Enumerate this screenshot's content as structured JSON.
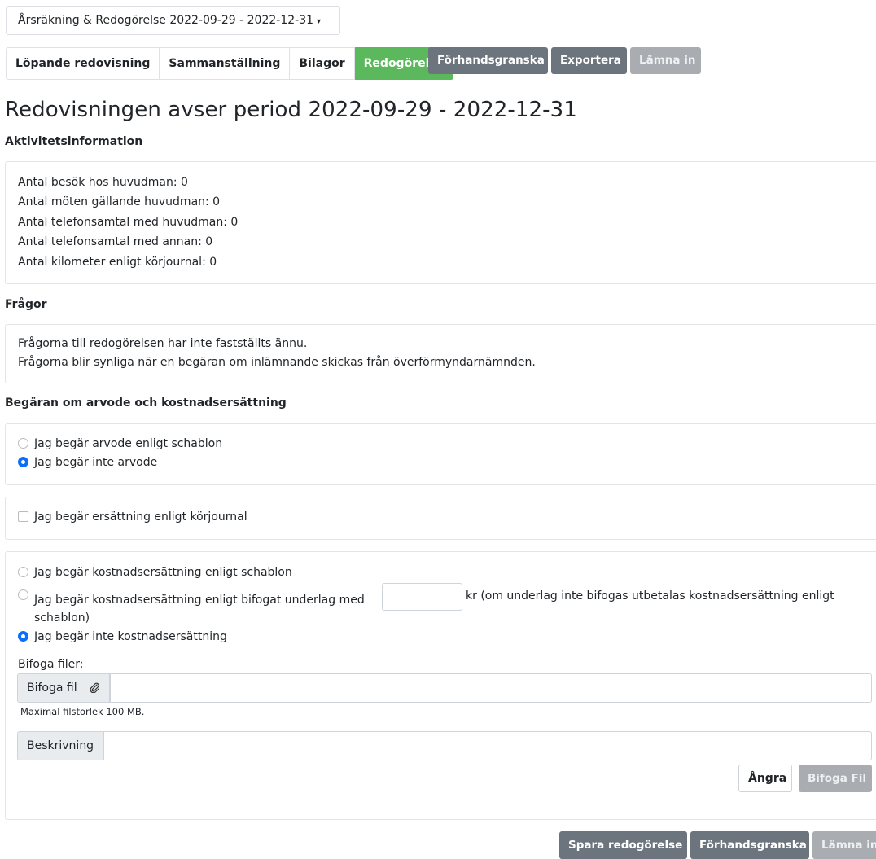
{
  "period_selector": {
    "label": "Årsräkning & Redogörelse 2022-09-29 - 2022-12-31",
    "caret": "▾"
  },
  "tabs": [
    {
      "label": "Löpande redovisning"
    },
    {
      "label": "Sammanställning"
    },
    {
      "label": "Bilagor"
    },
    {
      "label": "Redogörelse"
    }
  ],
  "top_actions": {
    "preview": "Förhandsgranska",
    "export": "Exportera",
    "submit": "Lämna in"
  },
  "title": "Redovisningen avser period 2022-09-29 - 2022-12-31",
  "activity": {
    "heading": "Aktivitetsinformation",
    "lines": [
      "Antal besök hos huvudman: 0",
      "Antal möten gällande huvudman: 0",
      "Antal telefonsamtal med huvudman: 0",
      "Antal telefonsamtal med annan: 0",
      "Antal kilometer enligt körjournal: 0"
    ]
  },
  "questions": {
    "heading": "Frågor",
    "lines": [
      "Frågorna till redogörelsen har inte fastställts ännu.",
      "Frågorna blir synliga när en begäran om inlämnande skickas från överförmyndarnämnden."
    ]
  },
  "fees": {
    "heading": "Begäran om arvode och kostnadsersättning",
    "fee_options": [
      "Jag begär arvode enligt schablon",
      "Jag begär inte arvode"
    ],
    "fee_selected_index": 1,
    "mileage_label": "Jag begär ersättning enligt körjournal",
    "mileage_checked": false,
    "cost_options": {
      "schablon": "Jag begär kostnadsersättning enligt schablon",
      "attached_prefix": "Jag begär kostnadsersättning enligt bifogat underlag med",
      "attached_suffix": "kr (om underlag inte bifogas utbetalas kostnadsersättning enligt",
      "attached_suffix_2": "schablon)",
      "none": "Jag begär inte kostnadsersättning"
    },
    "cost_selected": "none",
    "amount_value": "",
    "attach_label": "Bifoga filer:",
    "attach_button": "Bifoga fil",
    "file_value": "",
    "max_size": "Maximal filstorlek 100 MB.",
    "description_label": "Beskrivning",
    "description_value": "",
    "undo_button": "Ångra",
    "attach_submit_button": "Bifoga Fil"
  },
  "bottom_actions": {
    "save": "Spara redogörelse",
    "preview": "Förhandsgranska",
    "submit": "Lämna in"
  },
  "colors": {
    "active_tab": "#5cb85c",
    "dark_button": "#6c757d",
    "disabled_button": "#a9adb2",
    "radio_checked": "#0d6efd"
  }
}
